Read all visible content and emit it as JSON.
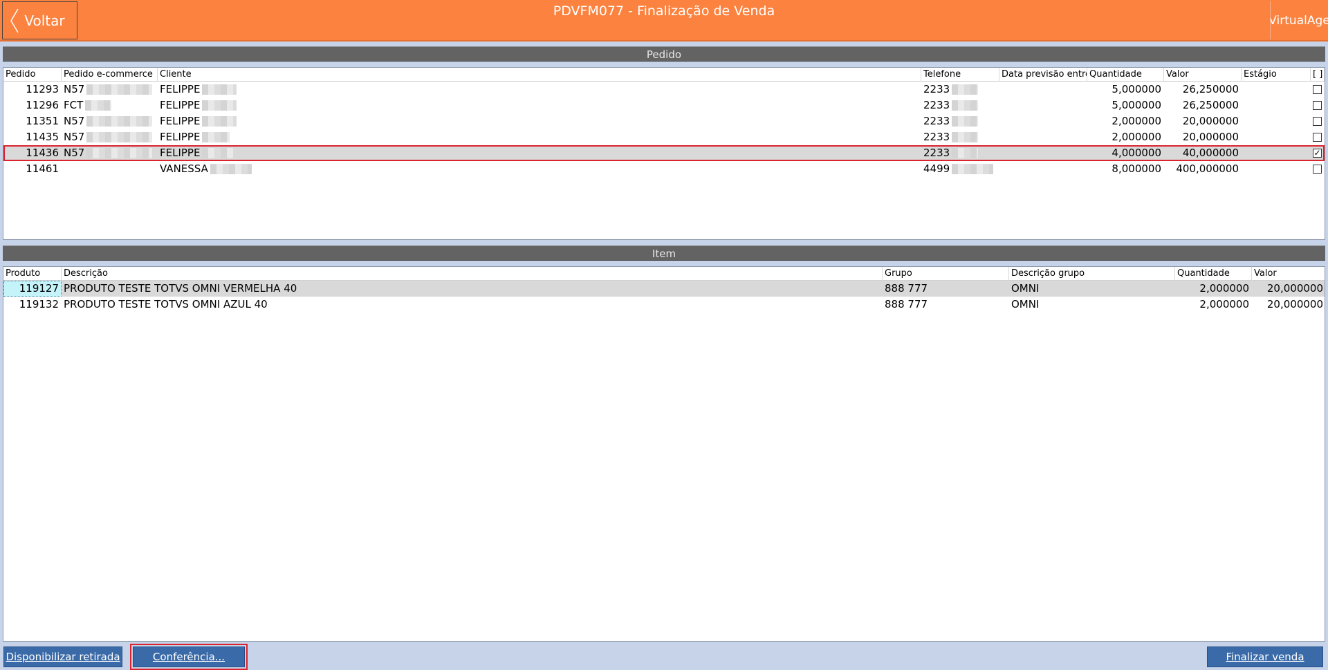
{
  "header": {
    "back_label": "Voltar",
    "title": "PDVFM077 - Finalização de Venda",
    "brand": "VirtualAge"
  },
  "pedido": {
    "section_title": "Pedido",
    "columns": [
      "Pedido",
      "Pedido e-commerce",
      "Cliente",
      "Telefone",
      "Data previsão entre",
      "Quantidade",
      "Valor",
      "Estágio",
      "[ ]"
    ],
    "rows": [
      {
        "pedido": "11293",
        "ecommerce": "N57",
        "cliente": "FELIPPE",
        "telefone": "2233",
        "quantidade": "5,000000",
        "valor": "26,250000",
        "checked": false
      },
      {
        "pedido": "11296",
        "ecommerce": "FCT",
        "cliente": "FELIPPE",
        "telefone": "2233",
        "quantidade": "5,000000",
        "valor": "26,250000",
        "checked": false
      },
      {
        "pedido": "11351",
        "ecommerce": "N57",
        "cliente": "FELIPPE",
        "telefone": "2233",
        "quantidade": "2,000000",
        "valor": "20,000000",
        "checked": false
      },
      {
        "pedido": "11435",
        "ecommerce": "N57",
        "cliente": "FELIPPE",
        "telefone": "2233",
        "quantidade": "2,000000",
        "valor": "20,000000",
        "checked": false
      },
      {
        "pedido": "11436",
        "ecommerce": "N57",
        "cliente": "FELIPPE",
        "telefone": "2233",
        "quantidade": "4,000000",
        "valor": "40,000000",
        "checked": true
      },
      {
        "pedido": "11461",
        "ecommerce": "",
        "cliente": "VANESSA",
        "telefone": "4499",
        "quantidade": "8,000000",
        "valor": "400,000000",
        "checked": false
      }
    ]
  },
  "item": {
    "section_title": "Item",
    "columns": [
      "Produto",
      "Descrição",
      "Grupo",
      "Descrição grupo",
      "Quantidade",
      "Valor"
    ],
    "rows": [
      {
        "produto": "119127",
        "descricao": "PRODUTO TESTE TOTVS OMNI VERMELHA 40",
        "grupo": "888 777",
        "descricao_grupo": "OMNI",
        "quantidade": "2,000000",
        "valor": "20,000000"
      },
      {
        "produto": "119132",
        "descricao": "PRODUTO TESTE TOTVS OMNI AZUL 40",
        "grupo": "888 777",
        "descricao_grupo": "OMNI",
        "quantidade": "2,000000",
        "valor": "20,000000"
      }
    ]
  },
  "footer": {
    "disponibilizar_label": "Disponibilizar retirada",
    "conferencia_label": "Conferência...",
    "finalizar_label": "Finalizar venda"
  },
  "colors": {
    "header_bg": "#fb823f",
    "button_bg": "#3a6aa8",
    "highlight": "#d9232e",
    "band_bg": "#636363"
  }
}
